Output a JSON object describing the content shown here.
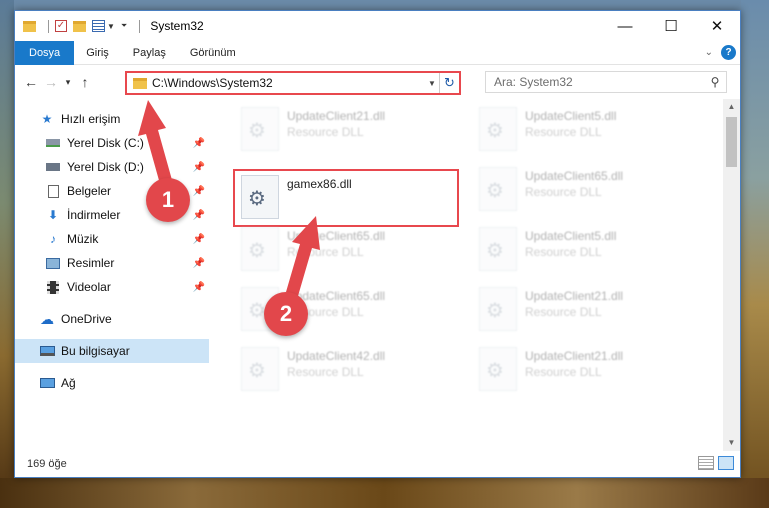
{
  "window": {
    "title": "System32",
    "controls": {
      "minimize": "—",
      "maximize": "☐",
      "close": "✕"
    }
  },
  "ribbon": {
    "tabs": [
      "Dosya",
      "Giriş",
      "Paylaş",
      "Görünüm"
    ]
  },
  "nav": {
    "back": "←",
    "forward": "→",
    "recent": "▾",
    "up": "↑",
    "address": "C:\\Windows\\System32",
    "search_placeholder": "Ara: System32"
  },
  "sidebar": {
    "items": [
      {
        "label": "Hızlı erişim",
        "icon": "star-icon",
        "pinned": false
      },
      {
        "label": "Yerel Disk (C:)",
        "icon": "drive-icon",
        "pinned": true
      },
      {
        "label": "Yerel Disk (D:)",
        "icon": "drive-icon",
        "pinned": true
      },
      {
        "label": "Belgeler",
        "icon": "documents-icon",
        "pinned": true
      },
      {
        "label": "İndirmeler",
        "icon": "download-icon",
        "pinned": true
      },
      {
        "label": "Müzik",
        "icon": "music-icon",
        "pinned": true
      },
      {
        "label": "Resimler",
        "icon": "pictures-icon",
        "pinned": true
      },
      {
        "label": "Videolar",
        "icon": "video-icon",
        "pinned": true
      },
      {
        "label": "OneDrive",
        "icon": "cloud-icon",
        "pinned": false
      },
      {
        "label": "Bu bilgisayar",
        "icon": "computer-icon",
        "pinned": false
      },
      {
        "label": "Ağ",
        "icon": "network-icon",
        "pinned": false
      }
    ]
  },
  "files": [
    {
      "name": "UpdateClient21.dll",
      "type": "Resource DLL"
    },
    {
      "name": "UpdateClient5.dll",
      "type": "Resource DLL"
    },
    {
      "name": "gamex86.dll",
      "type": ""
    },
    {
      "name": "UpdateClient65.dll",
      "type": "Resource DLL"
    },
    {
      "name": "UpdateClient65.dll",
      "type": "Resource DLL"
    },
    {
      "name": "UpdateClient5.dll",
      "type": "Resource DLL"
    },
    {
      "name": "UpdateClient65.dll",
      "type": "Resource DLL"
    },
    {
      "name": "UpdateClient21.dll",
      "type": "Resource DLL"
    },
    {
      "name": "UpdateClient42.dll",
      "type": "Resource DLL"
    },
    {
      "name": "UpdateClient21.dll",
      "type": "Resource DLL"
    }
  ],
  "status": {
    "item_count": "169 öğe"
  },
  "annotations": {
    "step1": "1",
    "step2": "2",
    "highlight_color": "#e8484e"
  }
}
